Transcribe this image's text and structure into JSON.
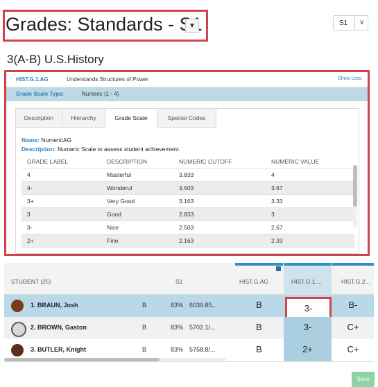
{
  "header": {
    "title": "Grades: Standards - S1",
    "title_dropdown_icon": "caret-down-icon",
    "term_select": {
      "value": "S1",
      "icon": "chevron-down-icon"
    }
  },
  "course": {
    "title": "3(A-B) U.S.History"
  },
  "standard": {
    "code": "HIST.G.1.AG",
    "description": "Understands Structures of Power",
    "toggle_label": "Show Less",
    "scale_type_label": "Grade Scale Type:",
    "scale_type_value": "Numeric (1 - 4)"
  },
  "tabs": [
    {
      "label": "Description",
      "active": false
    },
    {
      "label": "Hierarchy",
      "active": false
    },
    {
      "label": "Grade Scale",
      "active": true
    },
    {
      "label": "Special Codes",
      "active": false
    }
  ],
  "grade_scale": {
    "name_label": "Name:",
    "name_value": "NumericAG",
    "desc_label": "Description:",
    "desc_value": "Numeric Scale to assess student achievement.",
    "columns": [
      "GRADE LABEL",
      "DESCRIPTION",
      "NUMERIC CUTOFF",
      "NUMERIC VALUE"
    ],
    "rows": [
      [
        "4",
        "Masterful",
        "3.833",
        "4"
      ],
      [
        "4-",
        "Wonderul",
        "3.503",
        "3.67"
      ],
      [
        "3+",
        "Very Good",
        "3.163",
        "3.33"
      ],
      [
        "3",
        "Good",
        "2.833",
        "3"
      ],
      [
        "3-",
        "Nice",
        "2.503",
        "2.67"
      ],
      [
        "2+",
        "Fine",
        "2.163",
        "2.33"
      ]
    ]
  },
  "grid": {
    "headers": {
      "student": "STUDENT (25)",
      "term": "S1",
      "std1": "HIST.G.AG",
      "std2": "HIST.G.1....",
      "std3": "HIST.G.2..."
    },
    "students": [
      {
        "name": "1. BRAUN, Josh",
        "letter": "B",
        "percent": "83%",
        "points": "6039.85...",
        "g1": "B",
        "g2": "3-",
        "g3": "B-"
      },
      {
        "name": "2. BROWN, Gaston",
        "letter": "B",
        "percent": "83%",
        "points": "5702.1/...",
        "g1": "B",
        "g2": "3-",
        "g3": "C+"
      },
      {
        "name": "3. BUTLER, Knight",
        "letter": "B",
        "percent": "83%",
        "points": "5758.8/...",
        "g1": "B",
        "g2": "2+",
        "g3": "C+"
      }
    ]
  },
  "footer": {
    "save_label": "Save"
  },
  "colors": {
    "highlight_red": "#d0434b",
    "link_blue": "#2d7fb8",
    "scale_row_bg": "#bdd9e6",
    "selected_row_bg": "#b9d8e8",
    "save_green": "#8fd3a5"
  }
}
